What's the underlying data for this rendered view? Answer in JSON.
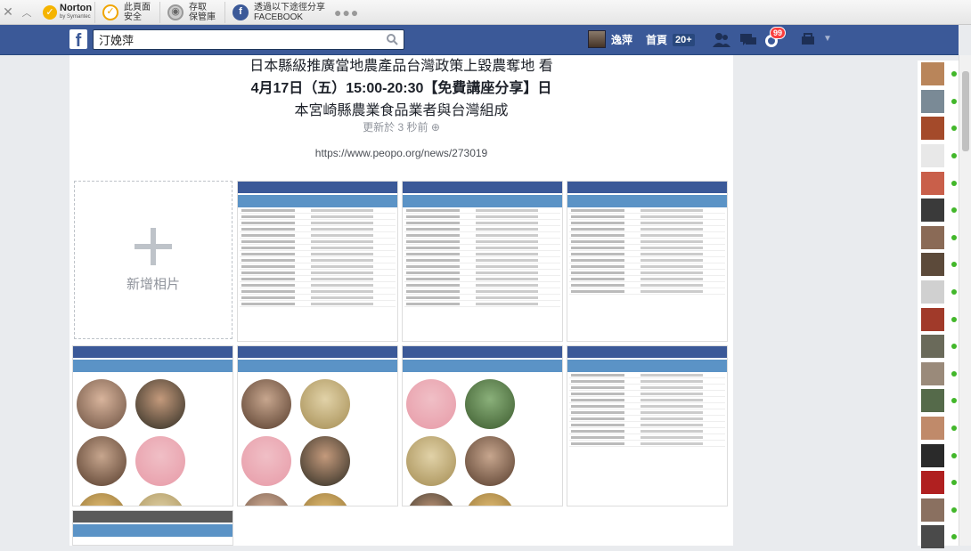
{
  "norton_bar": {
    "close": "✕",
    "collapse": "︿",
    "brand": "Norton",
    "brand_sub": "by Symantec",
    "items": [
      {
        "line1": "此頁面",
        "line2": "安全"
      },
      {
        "line1": "存取",
        "line2": "保管庫"
      },
      {
        "line1": "透過以下途徑分享",
        "line2": "FACEBOOK"
      }
    ],
    "more": "●●●"
  },
  "fb_bar": {
    "logo": "f",
    "search_value": "汀娩萍",
    "user_name": "逸萍",
    "home_label": "首頁",
    "home_count": "20+",
    "notif_count": "99",
    "brand_color": "#3b5998"
  },
  "post": {
    "title_line1": "日本縣級推廣當地農產品台灣政策上毀農奪地 看",
    "title_line2": "4月17日（五）15:00-20:30【免費講座分享】日",
    "title_line3": "本宮崎縣農業食品業者與台灣組成",
    "url": "https://www.peopo.org/news/273019",
    "updated": "更新於 3 秒前"
  },
  "album": {
    "add_label": "新增相片"
  }
}
